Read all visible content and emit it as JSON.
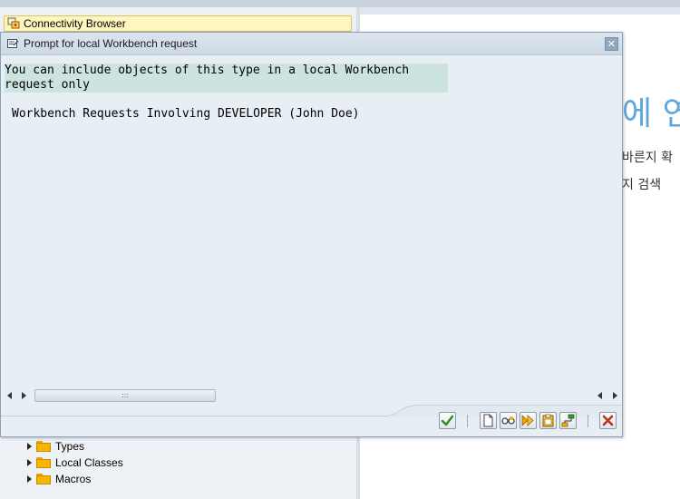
{
  "background": {
    "connectivity_tab_label": "Connectivity Browser",
    "korean_heading": "에 연",
    "korean_line1": "바른지 확",
    "korean_line2": "지 검색",
    "tree_items": [
      {
        "label": "Types"
      },
      {
        "label": "Local Classes"
      },
      {
        "label": "Macros"
      }
    ]
  },
  "dialog": {
    "title": "Prompt for local Workbench request",
    "close_glyph": "✕",
    "message_lines": [
      "You can include objects of this type in a local Workbench",
      "request only"
    ],
    "heading": "Workbench Requests Involving DEVELOPER (John Doe)",
    "scroll_thumb_grip": ":::",
    "toolbar": {
      "confirm_icon": "checkmark-icon",
      "buttons": [
        "document-icon",
        "display-icon",
        "forward-icon",
        "clipboard-icon",
        "hierarchy-icon"
      ],
      "cancel_icon": "cancel-icon"
    }
  },
  "colors": {
    "accent_blue": "#5fa6dc",
    "message_highlight": "#cde3e0",
    "confirm_green": "#2f8a1a",
    "cancel_red": "#c0301c"
  }
}
